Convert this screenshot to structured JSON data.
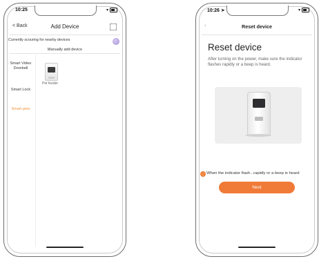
{
  "left_phone": {
    "time": "10:25",
    "back_label": "< Back",
    "title": "Add Device",
    "scan_status": "Currently scouring for nearby devices",
    "manual_label": "Manually add device",
    "categories": [
      "Smart Video Doorbell",
      "Smart Lock",
      "Smart pets"
    ],
    "active_category": "Smart pets",
    "device_label": "Pet feeder"
  },
  "right_phone": {
    "time": "10:26",
    "title": "Reset device",
    "heading": "Reset device",
    "description": "After turning on the power, make sure the indicator flashes rapidly or a beep is heard.",
    "confirm_text": "When the indicator flash...rapidly or a beep is heard",
    "next_label": "Next"
  },
  "colors": {
    "accent": "#f07a38",
    "active_category": "#f0933b"
  }
}
